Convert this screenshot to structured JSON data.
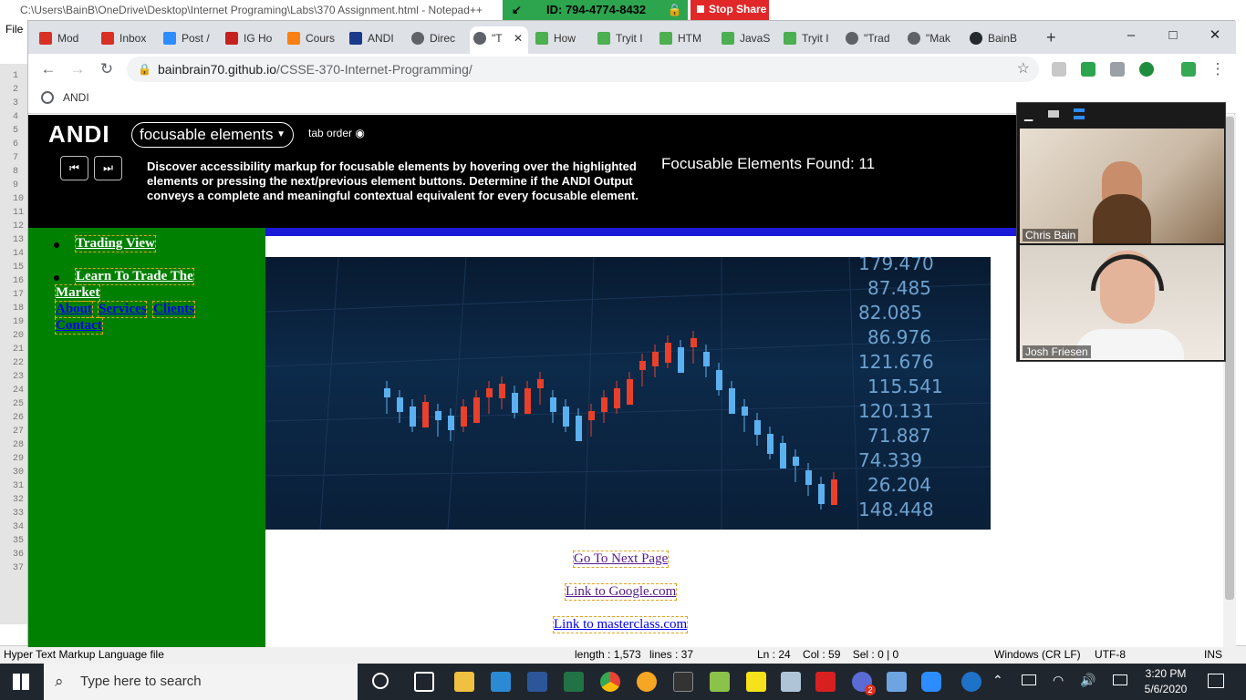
{
  "notepad": {
    "title": "C:\\Users\\BainB\\OneDrive\\Desktop\\Internet Programing\\Labs\\370 Assignment.html - Notepad++",
    "menu_file": "File",
    "line_numbers": [
      "1",
      "2",
      "3",
      "4",
      "5",
      "6",
      "7",
      "8",
      "9",
      "10",
      "11",
      "12",
      "13",
      "14",
      "15",
      "16",
      "17",
      "18",
      "19",
      "20",
      "21",
      "22",
      "23",
      "24",
      "25",
      "26",
      "27",
      "28",
      "29",
      "30",
      "31",
      "32",
      "33",
      "34",
      "35",
      "36",
      "37"
    ],
    "status": {
      "filetype": "Hyper Text Markup Language file",
      "length": "length : 1,573",
      "lines": "lines : 37",
      "position": "Ln : 24    Col : 59    Sel : 0 | 0",
      "eol": "Windows (CR LF)",
      "encoding": "UTF-8",
      "mode": "INS"
    }
  },
  "zoom": {
    "meeting_id": "ID: 794-4774-8432",
    "stop_share": "Stop Share",
    "participants": [
      {
        "name": "Chris Bain"
      },
      {
        "name": "Josh Friesen"
      }
    ]
  },
  "browser": {
    "tabs": [
      {
        "label": "Mod",
        "icon": "gmail-icon",
        "color": "#d93025"
      },
      {
        "label": "Inbox",
        "icon": "gmail-icon",
        "color": "#d93025"
      },
      {
        "label": "Post /",
        "icon": "zoom-icon",
        "color": "#2d8cff"
      },
      {
        "label": "IG Ho",
        "icon": "ig-icon",
        "color": "#c5221f"
      },
      {
        "label": "Cours",
        "icon": "moodle-icon",
        "color": "#f98012"
      },
      {
        "label": "ANDI",
        "icon": "ssa-icon",
        "color": "#1a3a8a"
      },
      {
        "label": "Direc",
        "icon": "globe-icon",
        "color": "#5f6368"
      },
      {
        "label": "\"T",
        "icon": "globe-icon",
        "color": "#5f6368"
      },
      {
        "label": "How",
        "icon": "w3-icon",
        "color": "#4caf50"
      },
      {
        "label": "Tryit I",
        "icon": "w3-icon",
        "color": "#4caf50"
      },
      {
        "label": "HTM",
        "icon": "w3-icon",
        "color": "#4caf50"
      },
      {
        "label": "JavaS",
        "icon": "w3-icon",
        "color": "#4caf50"
      },
      {
        "label": "Tryit I",
        "icon": "w3-icon",
        "color": "#4caf50"
      },
      {
        "label": "\"Trad",
        "icon": "globe-icon",
        "color": "#5f6368"
      },
      {
        "label": "\"Mak",
        "icon": "globe-icon",
        "color": "#5f6368"
      },
      {
        "label": "BainB",
        "icon": "github-icon",
        "color": "#24292e"
      }
    ],
    "url_host": "bainbrain70.github.io",
    "url_path": "/CSSE-370-Internet-Programming/",
    "bookmark": "ANDI"
  },
  "andi": {
    "logo": "ANDI",
    "module": "focusable elements",
    "tab_order": "tab order",
    "description": "Discover accessibility markup for focusable elements by hovering over the highlighted elements or pressing the next/previous element buttons. Determine if the ANDI Output conveys a complete and meaningful contextual equivalent for every focusable element.",
    "found_label": "Focusable Elements Found: 11"
  },
  "site": {
    "nav": {
      "trading_view": "Trading View",
      "learn_line1": "Learn To Trade The",
      "learn_line2": "Market",
      "about": "About",
      "services": "Services",
      "clients": "Clients",
      "contact": "Contact"
    },
    "hero_prices": [
      "179.470",
      "87.485",
      "82.085",
      "86.976",
      "121.676",
      "115.541",
      "120.131",
      "71.887",
      "74.339",
      "26.204",
      "148.448"
    ],
    "links": {
      "next_page": "Go To Next Page",
      "google": "Link to Google.com",
      "masterclass": "Link to masterclass.com"
    }
  },
  "taskbar": {
    "search_placeholder": "Type here to search",
    "time": "3:20 PM",
    "date": "5/6/2020",
    "notification_count": "2"
  },
  "colors": {
    "andi_bg": "#000000",
    "nav_green": "#008000",
    "zoom_green": "#2da44e",
    "stop_red": "#e02828",
    "focus_outline": "#e6a21c"
  }
}
